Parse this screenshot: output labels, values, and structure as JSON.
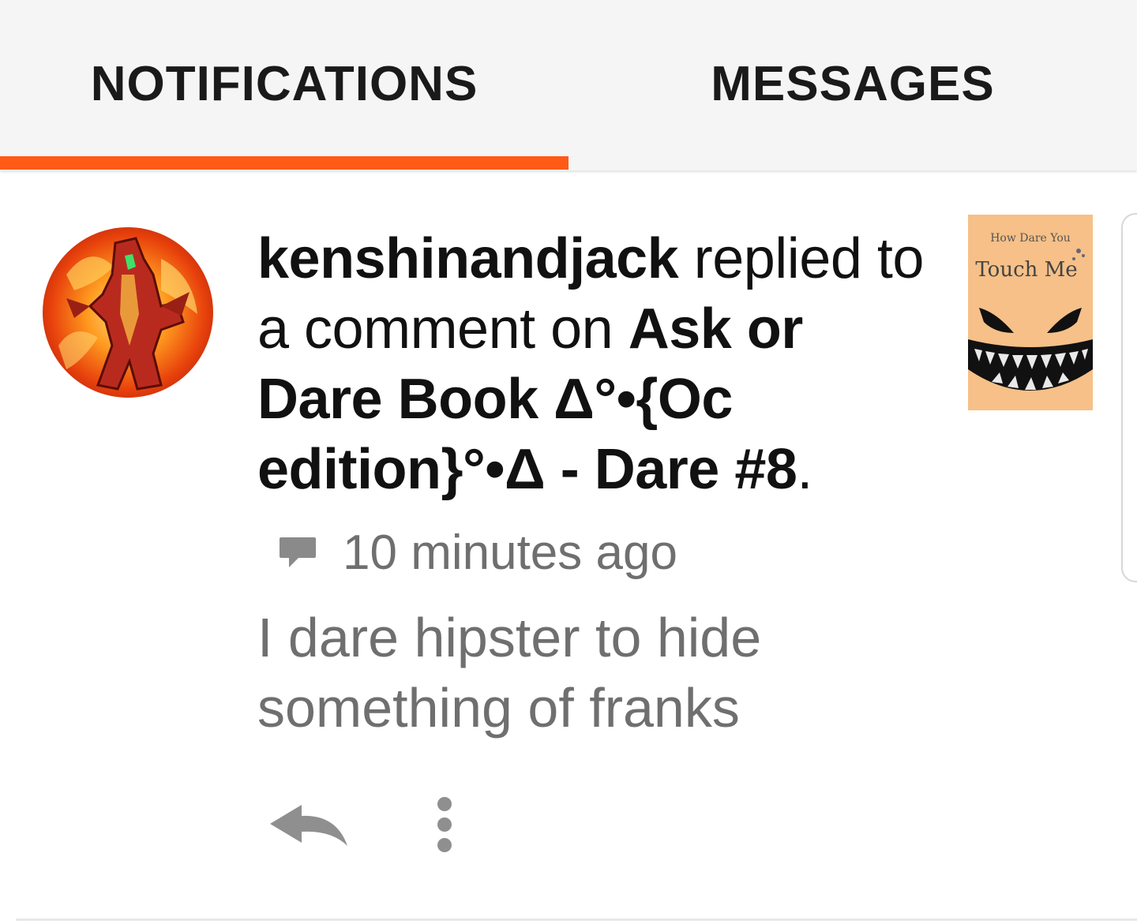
{
  "tabs": [
    {
      "label": "NOTIFICATIONS",
      "active": true
    },
    {
      "label": "MESSAGES",
      "active": false
    }
  ],
  "accent_color": "#ff5a16",
  "notification": {
    "username": "kenshinandjack",
    "action_text": " replied to a comment on ",
    "story_title": "Ask or Dare Book Δ°•{Oc edition}°•Δ - Dare #8",
    "end_punct": ".",
    "time_icon": "comment-bubble-icon",
    "time": "10 minutes ago",
    "comment": "I dare hipster to hide something of franks",
    "cover": {
      "line1": "How Dare You",
      "line2": "Touch Me"
    },
    "actions": {
      "reply_icon": "reply-arrow-icon",
      "more_icon": "more-vertical-icon"
    }
  }
}
